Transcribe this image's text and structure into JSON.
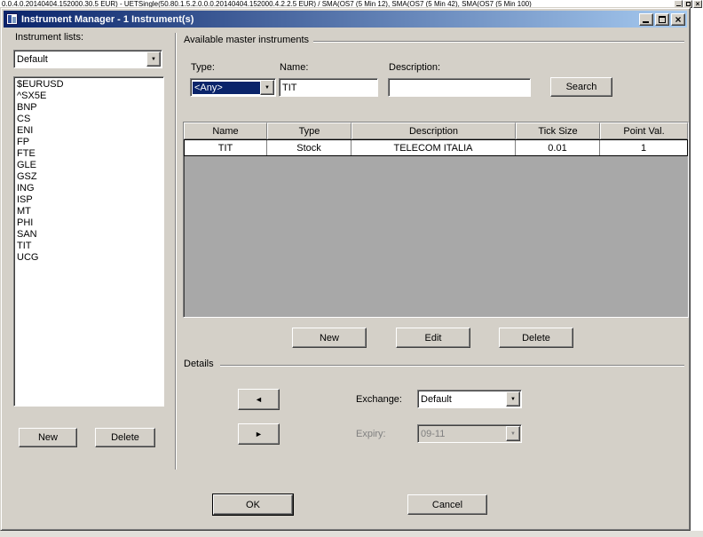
{
  "background": {
    "top_text": "0.0.4.0.20140404.152000.30.5 EUR) - UETSingle(50.80.1.5.2.0.0.0.20140404.152000.4.2.2.5 EUR) / SMA(OS7 (5 Min 12), SMA(OS7 (5 Min 42), SMA(OS7 (5 Min 100)"
  },
  "window": {
    "title": "Instrument Manager - 1 Instrument(s)"
  },
  "left_panel": {
    "label": "Instrument lists:",
    "selected_list": "Default",
    "items": [
      "$EURUSD",
      "^SX5E",
      "BNP",
      "CS",
      "ENI",
      "FP",
      "FTE",
      "GLE",
      "GSZ",
      "ING",
      "ISP",
      "MT",
      "PHI",
      "SAN",
      "TIT",
      "UCG"
    ],
    "new_button": "New",
    "delete_button": "Delete"
  },
  "master": {
    "section_title": "Available master instruments",
    "type_label": "Type:",
    "type_value": "<Any>",
    "name_label": "Name:",
    "name_value": "TIT",
    "description_label": "Description:",
    "description_value": "",
    "search_button": "Search",
    "table": {
      "columns": [
        "Name",
        "Type",
        "Description",
        "Tick Size",
        "Point Val."
      ],
      "rows": [
        [
          "TIT",
          "Stock",
          "TELECOM ITALIA",
          "0.01",
          "1"
        ]
      ]
    },
    "new_button": "New",
    "edit_button": "Edit",
    "delete_button": "Delete"
  },
  "details": {
    "section_title": "Details",
    "exchange_label": "Exchange:",
    "exchange_value": "Default",
    "expiry_label": "Expiry:",
    "expiry_value": "09-11"
  },
  "footer": {
    "ok_button": "OK",
    "cancel_button": "Cancel"
  },
  "colors": {
    "titlebar_start": "#0a246a",
    "titlebar_end": "#a6caf0",
    "dialog_bg": "#d4d0c8",
    "selection_bg": "#0a246a",
    "table_empty_bg": "#a8a8a8"
  },
  "icons": {
    "combo_arrow": "▼",
    "left_arrow": "◄",
    "right_arrow": "►",
    "close": "×"
  }
}
